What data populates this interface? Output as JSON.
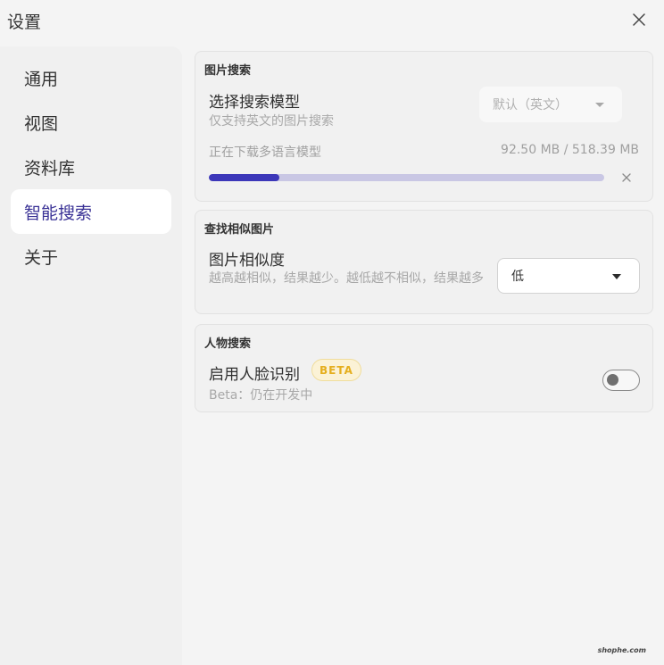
{
  "window": {
    "title": "设置"
  },
  "sidebar": {
    "items": [
      {
        "label": "通用",
        "active": false
      },
      {
        "label": "视图",
        "active": false
      },
      {
        "label": "资料库",
        "active": false
      },
      {
        "label": "智能搜索",
        "active": true
      },
      {
        "label": "关于",
        "active": false
      }
    ]
  },
  "image_search": {
    "section_title": "图片搜索",
    "model_label": "选择搜索模型",
    "model_desc": "仅支持英文的图片搜索",
    "model_select_value": "默认（英文）",
    "model_select_disabled": true,
    "download_status": "正在下载多语言模型",
    "download_size": "92.50 MB / 518.39 MB",
    "download_progress": 0.1784
  },
  "similar_search": {
    "section_title": "查找相似图片",
    "similarity_label": "图片相似度",
    "similarity_desc": "越高越相似，结果越少。越低越不相似，结果越多",
    "similarity_value": "低"
  },
  "person_search": {
    "section_title": "人物搜索",
    "face_label": "启用人脸识别",
    "badge": "BETA",
    "face_desc": "Beta：仍在开发中",
    "face_enabled": false
  },
  "watermark": "shophe.com",
  "colors": {
    "accent": "#3c37b9",
    "accent_light": "#c9c7e4",
    "beta_text": "#e5ae1d",
    "active_nav_text": "#3a3296"
  },
  "icons": {
    "close": "close-icon",
    "caret": "chevron-down-icon"
  }
}
